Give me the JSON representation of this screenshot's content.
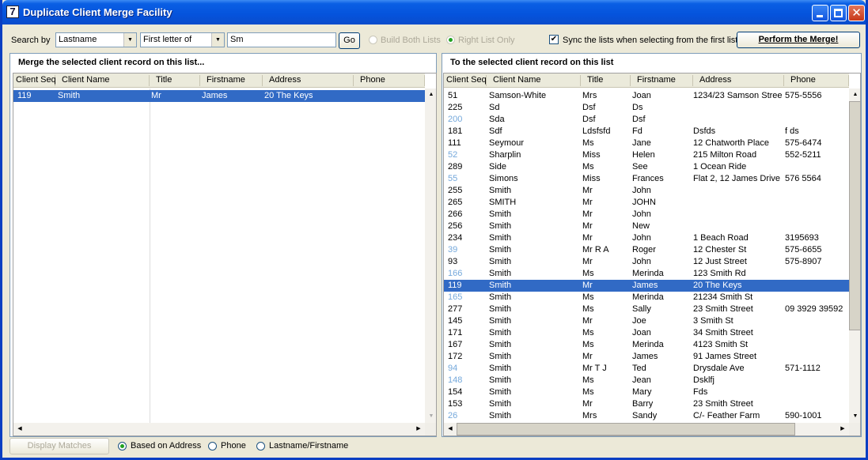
{
  "window": {
    "title": "Duplicate Client Merge Facility",
    "icon": "7"
  },
  "toolbar": {
    "search_by_label": "Search by",
    "search_field": "Lastname",
    "match_mode": "First letter of",
    "search_text": "Sm",
    "go_label": "Go",
    "build_both_label": "Build Both Lists",
    "right_list_only_label": "Right List Only",
    "sync_label": "Sync the lists when selecting from the first list",
    "sync_checked": true,
    "perform_label": "Perform the Merge!"
  },
  "left": {
    "title": "Merge the selected client record on this list...",
    "columns": [
      "Client Seq",
      "Client Name",
      "Title",
      "Firstname",
      "Address",
      "Phone"
    ],
    "rows": [
      {
        "seq": "119",
        "name": "Smith",
        "title": "Mr",
        "first": "James",
        "address": "20 The Keys",
        "phone": "",
        "selected": true
      }
    ]
  },
  "right": {
    "title": "To the selected client record on this list",
    "columns": [
      "Client Seq",
      "Client Name",
      "Title",
      "Firstname",
      "Address",
      "Phone"
    ],
    "rows": [
      {
        "seq": "51",
        "name": "Samson-White",
        "title": "Mrs",
        "first": "Joan",
        "address": "1234/23 Samson Stree",
        "phone": "575-5556"
      },
      {
        "seq": "225",
        "name": "Sd",
        "title": "Dsf",
        "first": "Ds",
        "address": "",
        "phone": ""
      },
      {
        "seq": "200",
        "name": "Sda",
        "title": "Dsf",
        "first": "Dsf",
        "address": "",
        "phone": "",
        "light": true
      },
      {
        "seq": "181",
        "name": "Sdf",
        "title": "Ldsfsfd",
        "first": "Fd",
        "address": "Dsfds",
        "phone": "f ds"
      },
      {
        "seq": "111",
        "name": "Seymour",
        "title": "Ms",
        "first": "Jane",
        "address": "12 Chatworth Place",
        "phone": "575-6474"
      },
      {
        "seq": "52",
        "name": "Sharplin",
        "title": "Miss",
        "first": "Helen",
        "address": "215 Milton Road",
        "phone": "552-5211",
        "light": true
      },
      {
        "seq": "289",
        "name": "Side",
        "title": "Ms",
        "first": "See",
        "address": "1 Ocean Ride",
        "phone": ""
      },
      {
        "seq": "55",
        "name": "Simons",
        "title": "Miss",
        "first": "Frances",
        "address": "Flat 2, 12 James Drive",
        "phone": "576 5564",
        "light": true
      },
      {
        "seq": "255",
        "name": "Smith",
        "title": "Mr",
        "first": "John",
        "address": "",
        "phone": ""
      },
      {
        "seq": "265",
        "name": "SMITH",
        "title": "Mr",
        "first": "JOHN",
        "address": "",
        "phone": ""
      },
      {
        "seq": "266",
        "name": "Smith",
        "title": "Mr",
        "first": "John",
        "address": "",
        "phone": ""
      },
      {
        "seq": "256",
        "name": "Smith",
        "title": "Mr",
        "first": "New",
        "address": "",
        "phone": ""
      },
      {
        "seq": "234",
        "name": "Smith",
        "title": "Mr",
        "first": "John",
        "address": "1 Beach Road",
        "phone": "3195693"
      },
      {
        "seq": "39",
        "name": "Smith",
        "title": "Mr R A",
        "first": "Roger",
        "address": "12 Chester St",
        "phone": "575-6655",
        "light": true
      },
      {
        "seq": "93",
        "name": "Smith",
        "title": "Mr",
        "first": "John",
        "address": "12 Just Street",
        "phone": "575-8907"
      },
      {
        "seq": "166",
        "name": "Smith",
        "title": "Ms",
        "first": "Merinda",
        "address": "123 Smith Rd",
        "phone": "",
        "light": true
      },
      {
        "seq": "119",
        "name": "Smith",
        "title": "Mr",
        "first": "James",
        "address": "20 The Keys",
        "phone": "",
        "selected": true
      },
      {
        "seq": "165",
        "name": "Smith",
        "title": "Ms",
        "first": "Merinda",
        "address": "21234 Smith St",
        "phone": "",
        "light": true
      },
      {
        "seq": "277",
        "name": "Smith",
        "title": "Ms",
        "first": "Sally",
        "address": "23 Smith Street",
        "phone": "09 3929 39592"
      },
      {
        "seq": "145",
        "name": "Smith",
        "title": "Mr",
        "first": "Joe",
        "address": "3 Smith St",
        "phone": ""
      },
      {
        "seq": "171",
        "name": "Smith",
        "title": "Ms",
        "first": "Joan",
        "address": "34 Smith Street",
        "phone": ""
      },
      {
        "seq": "167",
        "name": "Smith",
        "title": "Ms",
        "first": "Merinda",
        "address": "4123 Smith St",
        "phone": ""
      },
      {
        "seq": "172",
        "name": "Smith",
        "title": "Mr",
        "first": "James",
        "address": "91 James Street",
        "phone": ""
      },
      {
        "seq": "94",
        "name": "Smith",
        "title": "Mr T J",
        "first": "Ted",
        "address": "Drysdale Ave",
        "phone": "571-1112",
        "light": true
      },
      {
        "seq": "148",
        "name": "Smith",
        "title": "Ms",
        "first": "Jean",
        "address": "Dsklfj",
        "phone": "",
        "light": true
      },
      {
        "seq": "154",
        "name": "Smith",
        "title": "Ms",
        "first": "Mary",
        "address": "Fds",
        "phone": ""
      },
      {
        "seq": "153",
        "name": "Smith",
        "title": "Mr",
        "first": "Barry",
        "address": "23 Smith Street",
        "phone": ""
      },
      {
        "seq": "26",
        "name": "Smith",
        "title": "Mrs",
        "first": "Sandy",
        "address": "C/- Feather Farm",
        "phone": "590-1001",
        "light": true
      }
    ]
  },
  "bottom": {
    "display_matches_label": "Display Matches",
    "options": [
      {
        "label": "Based on Address",
        "checked": true
      },
      {
        "label": "Phone",
        "checked": false
      },
      {
        "label": "Lastname/Firstname",
        "checked": false
      }
    ]
  }
}
